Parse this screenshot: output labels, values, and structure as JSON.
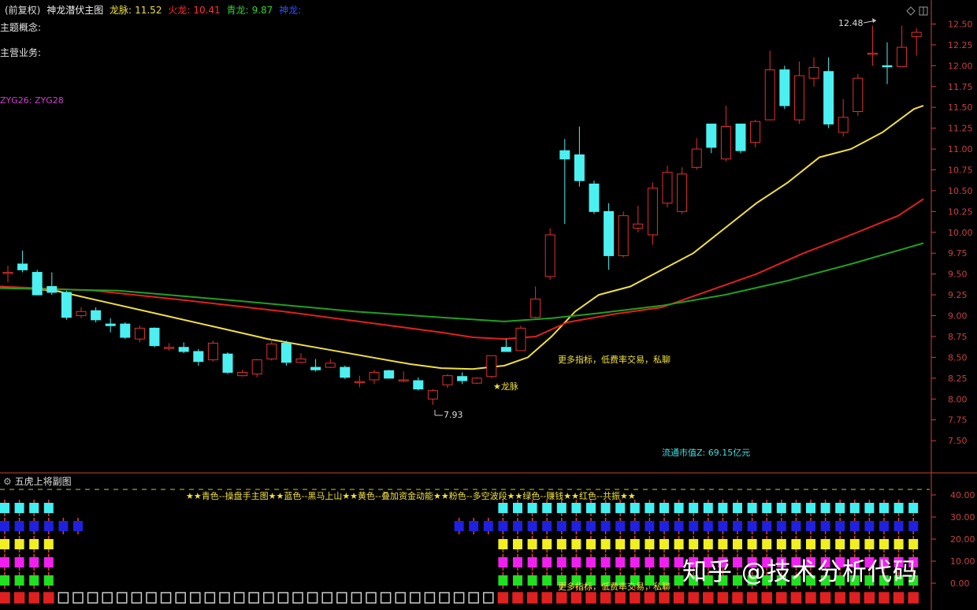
{
  "header": {
    "prefix": "(前复权)",
    "indicator_name": "神龙潜伏主图",
    "longmai_label": "龙脉:",
    "longmai_value": "11.52",
    "huolong_label": "火龙:",
    "huolong_value": "10.41",
    "qinglong_label": "青龙:",
    "qinglong_value": "9.87",
    "shenlong_label": "神龙:"
  },
  "info": {
    "topic_label": "主题概念:",
    "business_label": "主营业务:",
    "zyg_label": "ZYG26: ZYG28"
  },
  "annotations": {
    "high_price": "12.48",
    "low_price": "7.93",
    "longmai_marker": "★龙脉",
    "ad_text": "更多指标，低费率交易，私聊",
    "market_cap": "流通市值Z: 69.15亿元"
  },
  "sub_panel": {
    "title": "五虎上将副图",
    "legend": "★★青色--操盘手主图★★蓝色--黑马上山★★黄色--叠加资金动能★★粉色--多空波段★★绿色--赚钱★★红色--共振★★",
    "ad_text": "更多指标，低费率交易，私聊"
  },
  "watermark": "知乎 @技术分析代码",
  "colors": {
    "up": "#e03030",
    "down": "#4cf0f0",
    "ma_yellow": "#f0e040",
    "ma_red": "#e02020",
    "ma_green": "#20a020",
    "axis": "#c84040"
  },
  "chart_data": {
    "type": "candlestick",
    "ylim": [
      7.35,
      12.58
    ],
    "y_ticks": [
      "12.50",
      "12.25",
      "12.00",
      "11.75",
      "11.50",
      "11.25",
      "11.00",
      "10.75",
      "10.50",
      "10.25",
      "10.00",
      "9.75",
      "9.50",
      "9.25",
      "9.00",
      "8.75",
      "8.50",
      "8.25",
      "8.00",
      "7.75",
      "7.50"
    ],
    "candles": [
      {
        "o": 9.52,
        "h": 9.6,
        "l": 9.4,
        "c": 9.52
      },
      {
        "o": 9.62,
        "h": 9.78,
        "l": 9.52,
        "c": 9.55
      },
      {
        "o": 9.52,
        "h": 9.55,
        "l": 9.25,
        "c": 9.25
      },
      {
        "o": 9.35,
        "h": 9.52,
        "l": 9.25,
        "c": 9.28
      },
      {
        "o": 9.28,
        "h": 9.3,
        "l": 8.95,
        "c": 8.98
      },
      {
        "o": 9.0,
        "h": 9.1,
        "l": 8.97,
        "c": 9.05
      },
      {
        "o": 9.06,
        "h": 9.1,
        "l": 8.92,
        "c": 8.95
      },
      {
        "o": 8.9,
        "h": 8.97,
        "l": 8.8,
        "c": 8.88
      },
      {
        "o": 8.9,
        "h": 8.92,
        "l": 8.72,
        "c": 8.74
      },
      {
        "o": 8.72,
        "h": 8.88,
        "l": 8.68,
        "c": 8.85
      },
      {
        "o": 8.85,
        "h": 8.86,
        "l": 8.62,
        "c": 8.64
      },
      {
        "o": 8.62,
        "h": 8.67,
        "l": 8.58,
        "c": 8.62
      },
      {
        "o": 8.62,
        "h": 8.68,
        "l": 8.55,
        "c": 8.57
      },
      {
        "o": 8.57,
        "h": 8.6,
        "l": 8.4,
        "c": 8.45
      },
      {
        "o": 8.47,
        "h": 8.7,
        "l": 8.45,
        "c": 8.67
      },
      {
        "o": 8.54,
        "h": 8.56,
        "l": 8.3,
        "c": 8.32
      },
      {
        "o": 8.28,
        "h": 8.35,
        "l": 8.27,
        "c": 8.32
      },
      {
        "o": 8.3,
        "h": 8.48,
        "l": 8.26,
        "c": 8.47
      },
      {
        "o": 8.48,
        "h": 8.72,
        "l": 8.46,
        "c": 8.66
      },
      {
        "o": 8.67,
        "h": 8.7,
        "l": 8.4,
        "c": 8.44
      },
      {
        "o": 8.44,
        "h": 8.55,
        "l": 8.43,
        "c": 8.48
      },
      {
        "o": 8.38,
        "h": 8.48,
        "l": 8.33,
        "c": 8.35
      },
      {
        "o": 8.38,
        "h": 8.48,
        "l": 8.37,
        "c": 8.43
      },
      {
        "o": 8.38,
        "h": 8.4,
        "l": 8.24,
        "c": 8.26
      },
      {
        "o": 8.2,
        "h": 8.28,
        "l": 8.14,
        "c": 8.21
      },
      {
        "o": 8.23,
        "h": 8.35,
        "l": 8.18,
        "c": 8.32
      },
      {
        "o": 8.34,
        "h": 8.35,
        "l": 8.25,
        "c": 8.25
      },
      {
        "o": 8.22,
        "h": 8.33,
        "l": 8.2,
        "c": 8.23
      },
      {
        "o": 8.22,
        "h": 8.26,
        "l": 8.1,
        "c": 8.12
      },
      {
        "o": 8.0,
        "h": 8.12,
        "l": 7.93,
        "c": 8.1
      },
      {
        "o": 8.17,
        "h": 8.3,
        "l": 8.13,
        "c": 8.28
      },
      {
        "o": 8.27,
        "h": 8.32,
        "l": 8.18,
        "c": 8.22
      },
      {
        "o": 8.19,
        "h": 8.26,
        "l": 8.18,
        "c": 8.25
      },
      {
        "o": 8.27,
        "h": 8.52,
        "l": 8.25,
        "c": 8.52
      },
      {
        "o": 8.62,
        "h": 8.72,
        "l": 8.6,
        "c": 8.57
      },
      {
        "o": 8.58,
        "h": 8.88,
        "l": 8.58,
        "c": 8.85
      },
      {
        "o": 8.98,
        "h": 9.35,
        "l": 8.97,
        "c": 9.2
      },
      {
        "o": 9.47,
        "h": 10.05,
        "l": 9.43,
        "c": 9.97
      },
      {
        "o": 10.98,
        "h": 11.12,
        "l": 10.1,
        "c": 10.88
      },
      {
        "o": 10.93,
        "h": 11.27,
        "l": 10.55,
        "c": 10.62
      },
      {
        "o": 10.58,
        "h": 10.62,
        "l": 10.22,
        "c": 10.25
      },
      {
        "o": 10.25,
        "h": 10.35,
        "l": 9.55,
        "c": 9.72
      },
      {
        "o": 9.72,
        "h": 10.25,
        "l": 9.7,
        "c": 10.2
      },
      {
        "o": 10.05,
        "h": 10.32,
        "l": 10.0,
        "c": 10.1
      },
      {
        "o": 9.97,
        "h": 10.6,
        "l": 9.85,
        "c": 10.53
      },
      {
        "o": 10.35,
        "h": 10.8,
        "l": 10.3,
        "c": 10.72
      },
      {
        "o": 10.25,
        "h": 10.78,
        "l": 10.22,
        "c": 10.7
      },
      {
        "o": 10.78,
        "h": 11.13,
        "l": 10.75,
        "c": 11.0
      },
      {
        "o": 11.3,
        "h": 11.3,
        "l": 10.95,
        "c": 11.02
      },
      {
        "o": 10.88,
        "h": 11.52,
        "l": 10.85,
        "c": 11.27
      },
      {
        "o": 11.3,
        "h": 11.3,
        "l": 10.95,
        "c": 10.98
      },
      {
        "o": 11.08,
        "h": 11.35,
        "l": 11.02,
        "c": 11.33
      },
      {
        "o": 11.35,
        "h": 12.18,
        "l": 11.35,
        "c": 11.95
      },
      {
        "o": 11.95,
        "h": 12.0,
        "l": 11.48,
        "c": 11.52
      },
      {
        "o": 11.35,
        "h": 12.05,
        "l": 11.3,
        "c": 11.88
      },
      {
        "o": 11.85,
        "h": 12.1,
        "l": 11.75,
        "c": 11.98
      },
      {
        "o": 11.93,
        "h": 12.1,
        "l": 11.25,
        "c": 11.3
      },
      {
        "o": 11.2,
        "h": 11.6,
        "l": 11.15,
        "c": 11.38
      },
      {
        "o": 11.45,
        "h": 11.9,
        "l": 11.4,
        "c": 11.85
      },
      {
        "o": 12.15,
        "h": 12.48,
        "l": 12.0,
        "c": 12.15
      },
      {
        "o": 12.0,
        "h": 12.28,
        "l": 11.78,
        "c": 11.99
      },
      {
        "o": 11.99,
        "h": 12.48,
        "l": 11.99,
        "c": 12.22
      },
      {
        "o": 12.35,
        "h": 12.45,
        "l": 12.12,
        "c": 12.4
      }
    ],
    "series": [
      {
        "color": "#f0e040",
        "values": [
          [
            0,
            9.35
          ],
          [
            70,
            9.3
          ],
          [
            140,
            9.15
          ],
          [
            210,
            9.0
          ],
          [
            280,
            8.85
          ],
          [
            340,
            8.72
          ],
          [
            400,
            8.62
          ],
          [
            460,
            8.52
          ],
          [
            520,
            8.42
          ],
          [
            560,
            8.37
          ],
          [
            600,
            8.36
          ],
          [
            640,
            8.4
          ],
          [
            670,
            8.5
          ],
          [
            700,
            8.75
          ],
          [
            730,
            9.05
          ],
          [
            760,
            9.25
          ],
          [
            800,
            9.35
          ],
          [
            840,
            9.55
          ],
          [
            880,
            9.75
          ],
          [
            920,
            10.05
          ],
          [
            960,
            10.35
          ],
          [
            1000,
            10.6
          ],
          [
            1040,
            10.9
          ],
          [
            1080,
            11.0
          ],
          [
            1120,
            11.2
          ],
          [
            1160,
            11.48
          ],
          [
            1172,
            11.52
          ]
        ]
      },
      {
        "color": "#e02020",
        "values": [
          [
            0,
            9.35
          ],
          [
            120,
            9.3
          ],
          [
            240,
            9.18
          ],
          [
            360,
            9.05
          ],
          [
            480,
            8.9
          ],
          [
            560,
            8.8
          ],
          [
            600,
            8.74
          ],
          [
            640,
            8.72
          ],
          [
            680,
            8.75
          ],
          [
            720,
            8.92
          ],
          [
            780,
            9.02
          ],
          [
            840,
            9.1
          ],
          [
            900,
            9.3
          ],
          [
            960,
            9.5
          ],
          [
            1020,
            9.75
          ],
          [
            1080,
            9.97
          ],
          [
            1140,
            10.2
          ],
          [
            1172,
            10.4
          ]
        ]
      },
      {
        "color": "#20a020",
        "values": [
          [
            0,
            9.33
          ],
          [
            150,
            9.3
          ],
          [
            300,
            9.18
          ],
          [
            450,
            9.05
          ],
          [
            560,
            8.98
          ],
          [
            640,
            8.93
          ],
          [
            700,
            8.97
          ],
          [
            760,
            9.03
          ],
          [
            840,
            9.12
          ],
          [
            920,
            9.25
          ],
          [
            1000,
            9.42
          ],
          [
            1080,
            9.62
          ],
          [
            1172,
            9.87
          ]
        ]
      }
    ]
  }
}
